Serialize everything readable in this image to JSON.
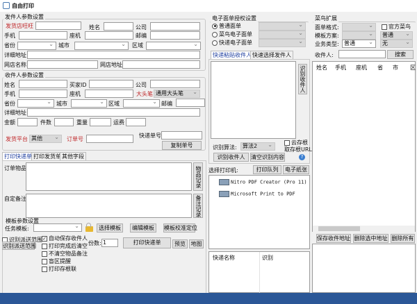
{
  "title": "自由打印",
  "sender": {
    "group": "发件人参数设置",
    "shop_ww": "发货店旺旺",
    "name": "姓名",
    "company": "公司",
    "mobile": "手机",
    "phone": "座机",
    "zip": "邮编",
    "province": "省份",
    "city": "城市",
    "district": "区域",
    "address": "详细地址",
    "shop_name": "网店名称",
    "shop_addr": "网店地址"
  },
  "receiver": {
    "group": "收件人参数设置",
    "name": "姓名",
    "buyer_id": "买家ID",
    "company": "公司",
    "mobile": "手机",
    "phone": "座机",
    "big_head": "大头笔",
    "big_head_value": "通用大头笔",
    "province": "省份",
    "city": "城市",
    "district": "区域",
    "zip": "邮编",
    "address": "详细地址",
    "amount": "金额",
    "count": "件数",
    "weight": "重量",
    "freight": "运费",
    "platform": "发货平台",
    "platform_value": "其他",
    "order_no": "订单号",
    "express_no": "快递单号",
    "copy_btn": "复制单号"
  },
  "tabs": [
    "打印快递单",
    "打印发货单",
    "其他字段"
  ],
  "print": {
    "items": "订单物品",
    "items_btn": "物品记录",
    "note": "自定备注",
    "note_btn": "备注记录",
    "tpl_group": "模板参数设置",
    "task_tpl": "任务模板:",
    "select_tpl": "选择模板",
    "edit_tpl": "编辑模板",
    "calib_tpl": "模板校准定位",
    "range_cb": "识别派送范围",
    "range_btn": "识别派送范围",
    "checks": [
      {
        "label": "自动保存收件人",
        "checked": true
      },
      {
        "label": "打印完成后清空",
        "checked": false
      },
      {
        "label": "不清空物品备注",
        "checked": false
      },
      {
        "label": "盲区提醒",
        "checked": false
      },
      {
        "label": "打印存根联",
        "checked": false
      }
    ],
    "copies_label": "份数:",
    "copies": "1",
    "print_btn": "打印快递单",
    "preview": "预览",
    "map": "地图"
  },
  "esheet": {
    "group": "电子面单授权设置",
    "options": [
      {
        "label": "普通面单",
        "checked": true
      },
      {
        "label": "菜鸟电子面单",
        "checked": false
      },
      {
        "label": "快递电子面单",
        "checked": false
      }
    ]
  },
  "paste": {
    "tabs": [
      "快递粘贴收件人",
      "快速选择发件人"
    ],
    "recog_btn_v": "识别收件人",
    "algo_label": "识别算法:",
    "algo_value": "算法2",
    "cloud_cb": "云存根",
    "get_url": "取存根URL",
    "recog_btn": "识别收件人",
    "clear_btn": "清空识别内容"
  },
  "printer": {
    "label": "选择打印机:",
    "queue": "打印队列",
    "paper": "电子纸张",
    "list": [
      "Nitro PDF Creator (Pro 11)",
      "Microsoft Print to PDF"
    ]
  },
  "express_table": {
    "headers": [
      "快递名称",
      "识别"
    ]
  },
  "cainiao": {
    "group": "菜鸟扩展",
    "format": "面单格式:",
    "official": "官方菜鸟",
    "scheme": "模板方案:",
    "scheme_value": "普通",
    "biz": "业务类型:",
    "biz_value": "普通",
    "biz_value2": "无"
  },
  "search": {
    "label": "收件人:",
    "btn": "搜索"
  },
  "addr_table": {
    "headers": [
      "姓名",
      "手机",
      "座机",
      "省",
      "市",
      "区"
    ]
  },
  "addr_btns": [
    "保存收件地址",
    "删除选中地址",
    "删除所有"
  ],
  "colors": {
    "taskbar": "#2b5797",
    "required": "#c0282a"
  }
}
